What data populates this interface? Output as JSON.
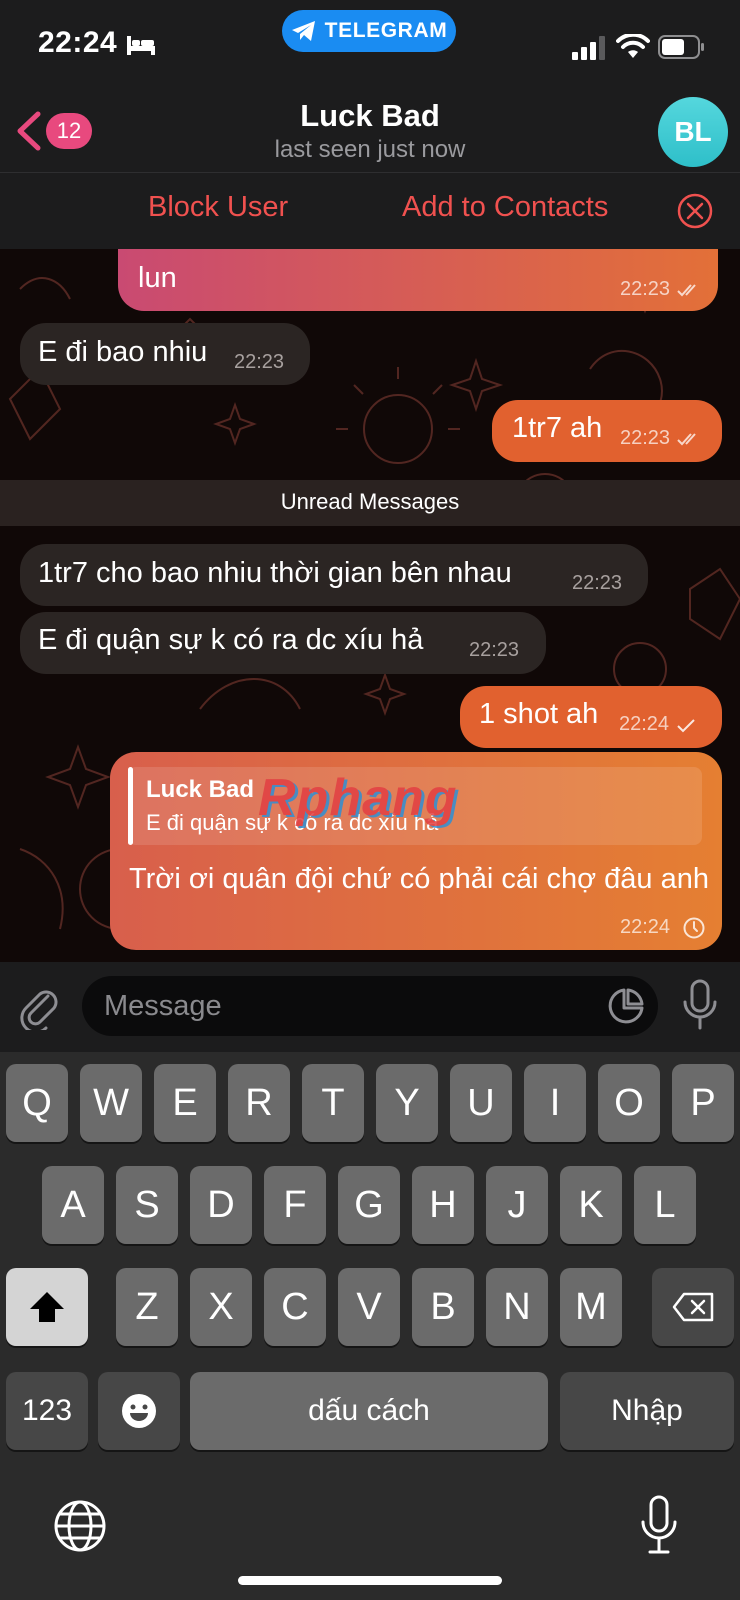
{
  "status_bar": {
    "time": "22:24",
    "app_pill": "TELEGRAM"
  },
  "header": {
    "unread_count": "12",
    "title": "Luck Bad",
    "subtitle": "last seen just now",
    "avatar_initials": "BL"
  },
  "action_bar": {
    "block_label": "Block User",
    "add_label": "Add to Contacts"
  },
  "messages": [
    {
      "direction": "out",
      "text": "lun",
      "time": "22:23",
      "status": "read"
    },
    {
      "direction": "in",
      "text": "E đi bao nhiu",
      "time": "22:23"
    },
    {
      "direction": "out",
      "text": "1tr7 ah",
      "time": "22:23",
      "status": "read"
    },
    {
      "direction": "in",
      "text": "1tr7 cho bao nhiu thời gian bên nhau",
      "time": "22:23"
    },
    {
      "direction": "in",
      "text": "E đi quận sự k có ra dc xíu hả",
      "time": "22:23"
    },
    {
      "direction": "out",
      "text": "1 shot ah",
      "time": "22:24",
      "status": "sent"
    },
    {
      "direction": "out",
      "reply_to_name": "Luck Bad",
      "reply_to_text": "E đi quận sự k có ra dc xíu hả",
      "text": "Trời ơi quân đội chứ có phải cái chợ đâu anh",
      "time": "22:24",
      "status": "pending"
    }
  ],
  "unread_divider": "Unread Messages",
  "watermark": "Rphang",
  "composer": {
    "placeholder": "Message"
  },
  "keyboard": {
    "row1": [
      "Q",
      "W",
      "E",
      "R",
      "T",
      "Y",
      "U",
      "I",
      "O",
      "P"
    ],
    "row2": [
      "A",
      "S",
      "D",
      "F",
      "G",
      "H",
      "J",
      "K",
      "L"
    ],
    "row3": [
      "Z",
      "X",
      "C",
      "V",
      "B",
      "N",
      "M"
    ],
    "numbers_key": "123",
    "space_key": "dấu cách",
    "return_key": "Nhập"
  },
  "colors": {
    "accent_red": "#f0514f",
    "badge_pink": "#e8497e",
    "outgoing_orange": "#e1612f",
    "pill_blue": "#1a8cf2"
  }
}
